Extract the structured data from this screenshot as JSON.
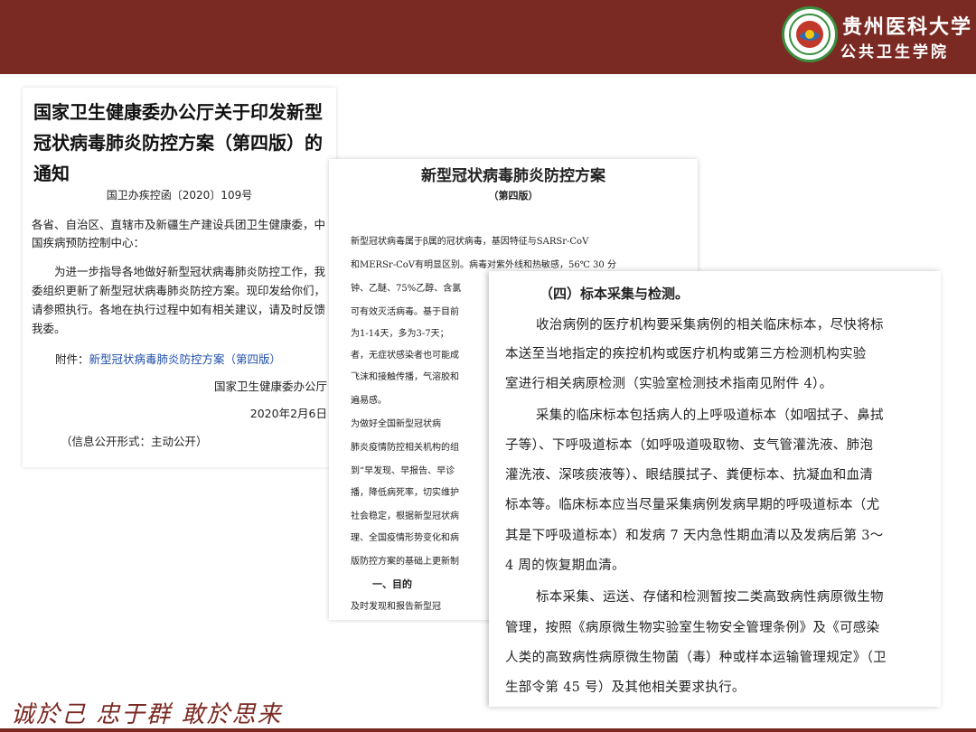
{
  "header": {
    "logo_line1": "贵州医科大学",
    "logo_line2": "公共卫生学院"
  },
  "slogan": "诚於己 忠于群 敢於思来",
  "colors": {
    "header_bg": "#7a2a23",
    "link": "#1f4fa8"
  },
  "notice": {
    "title": "国家卫生健康委办公厅关于印发新型冠状病毒肺炎防控方案（第四版）的通知",
    "doc_number": "国卫办疾控函〔2020〕109号",
    "recipients": "各省、自治区、直辖市及新疆生产建设兵团卫生健康委，中国疾病预防控制中心：",
    "body": "为进一步指导各地做好新型冠状病毒肺炎防控工作，我委组织更新了新型冠状病毒肺炎防控方案。现印发给你们，请参照执行。各地在执行过程中如有相关建议，请及时反馈我委。",
    "attachment_label": "附件：",
    "attachment_link": "新型冠状病毒肺炎防控方案（第四版）",
    "issuer": "国家卫生健康委办公厅",
    "date": "2020年2月6日",
    "disclosure": "（信息公开形式：主动公开）"
  },
  "plan": {
    "title": "新型冠状病毒肺炎防控方案",
    "edition": "（第四版）",
    "lines": [
      "    新型冠状病毒属于β属的冠状病毒，基因特征与SARSr-CoV",
      "和MERSr-CoV有明显区别。病毒对紫外线和热敏感，56℃ 30 分",
      "钟、乙醚、75%乙醇、含氯",
      "可有效灭活病毒。基于目前",
      "为1-14天，多为3-7天；",
      "者，无症状感染者也可能成",
      "飞沫和接触传播，气溶胶和",
      "遍易感。",
      "    为做好全国新型冠状病",
      "肺炎疫情防控相关机构的组",
      "到“早发现、早报告、早诊",
      "播，降低病死率，切实维护",
      "社会稳定，根据新型冠状病",
      "理、全国疫情形势变化和病",
      "版防控方案的基础上更新制"
    ],
    "section_heading": "一、目的",
    "last_line": "    及时发现和报告新型冠"
  },
  "sample": {
    "heading": "（四）标本采集与检测。",
    "lines": [
      {
        "text": "收治病例的医疗机构要采集病例的相关临床标本，尽快将标",
        "indent": true
      },
      {
        "text": "本送至当地指定的疾控机构或医疗机构或第三方检测机构实验",
        "indent": false
      },
      {
        "text": "室进行相关病原检测（实验室检测技术指南见附件 4）。",
        "indent": false
      },
      {
        "text": "采集的临床标本包括病人的上呼吸道标本（如咽拭子、鼻拭",
        "indent": true
      },
      {
        "text": "子等）、下呼吸道标本（如呼吸道吸取物、支气管灌洗液、肺泡",
        "indent": false
      },
      {
        "text": "灌洗液、深咳痰液等）、眼结膜拭子、粪便标本、抗凝血和血清",
        "indent": false
      },
      {
        "text": "标本等。临床标本应当尽量采集病例发病早期的呼吸道标本（尤",
        "indent": false
      },
      {
        "text": "其是下呼吸道标本）和发病 7 天内急性期血清以及发病后第 3～",
        "indent": false
      },
      {
        "text": "4 周的恢复期血清。",
        "indent": false
      },
      {
        "text": "标本采集、运送、存储和检测暂按二类高致病性病原微生物",
        "indent": true
      },
      {
        "text": "管理，按照《病原微生物实验室生物安全管理条例》及《可感染",
        "indent": false
      },
      {
        "text": "人类的高致病性病原微生物菌（毒）种或样本运输管理规定》（卫",
        "indent": false
      },
      {
        "text": "生部令第 45 号）及其他相关要求执行。",
        "indent": false
      }
    ]
  }
}
